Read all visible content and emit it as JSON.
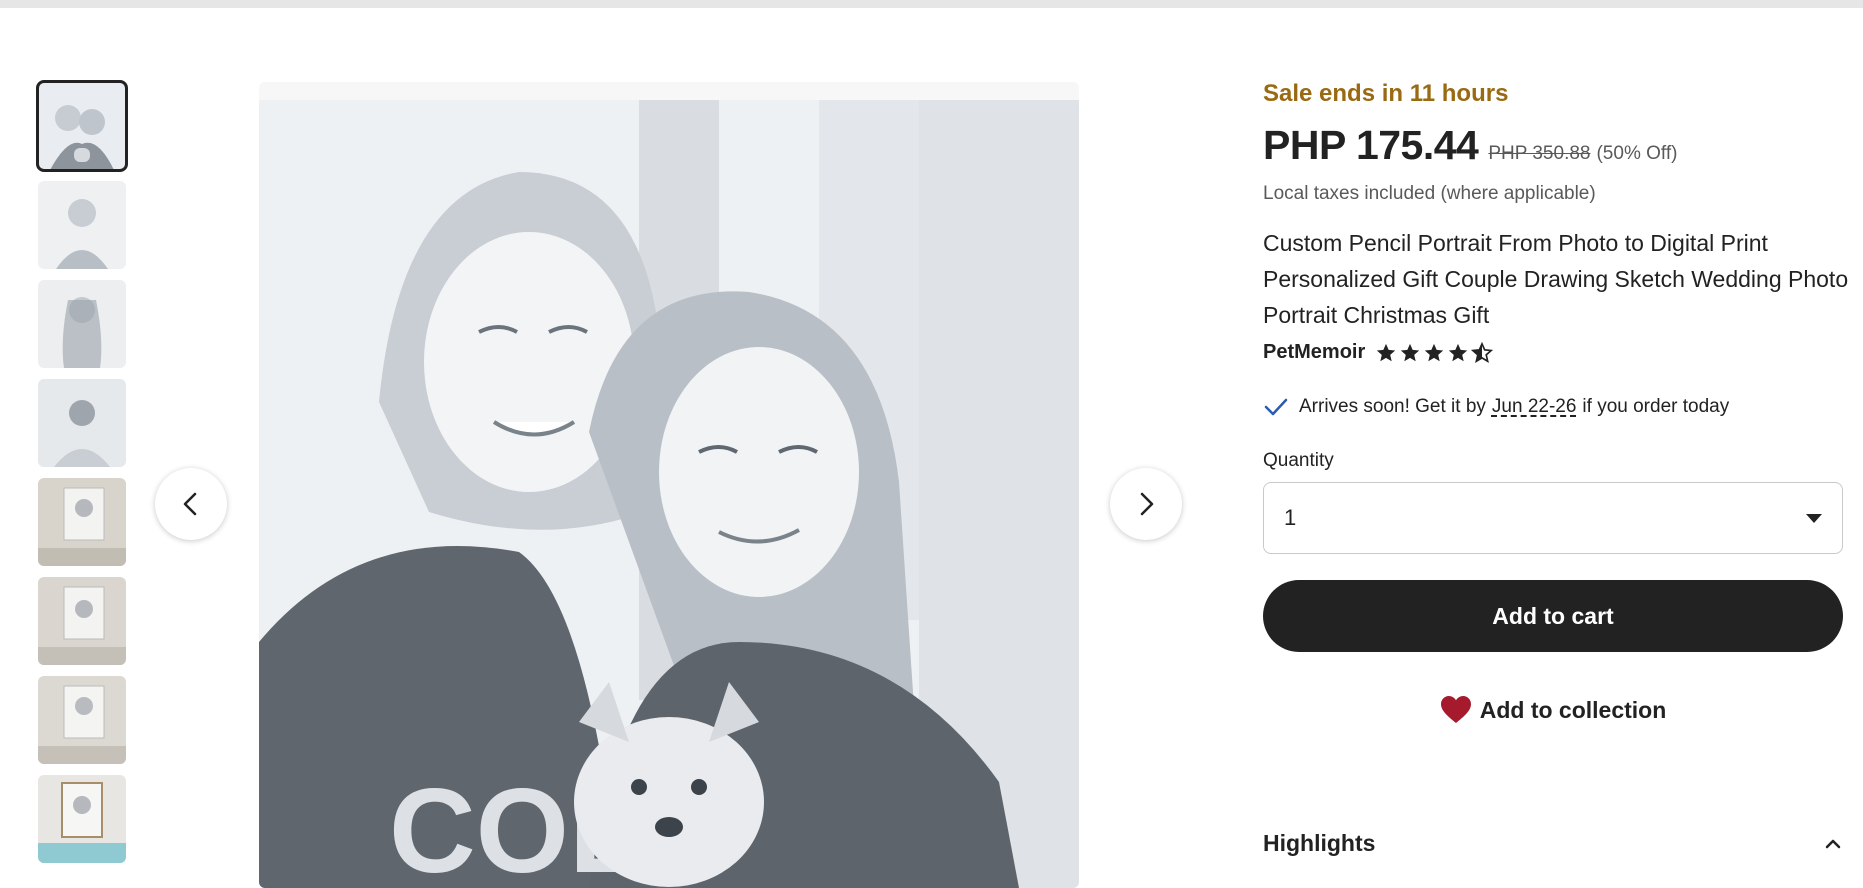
{
  "gallery": {
    "thumbnails": [
      "thumb-1",
      "thumb-2",
      "thumb-3",
      "thumb-4",
      "thumb-5",
      "thumb-6",
      "thumb-7",
      "thumb-8"
    ],
    "active_index": 0,
    "prev_icon": "chevron-left-icon",
    "next_icon": "chevron-right-icon"
  },
  "product": {
    "sale_text": "Sale ends in 11 hours",
    "price": "PHP 175.44",
    "original_price": "PHP 350.88",
    "discount": "(50% Off)",
    "taxes_note": "Local taxes included (where applicable)",
    "title": "Custom Pencil Portrait From Photo to Digital Print Personalized Gift Couple Drawing Sketch Wedding Photo Portrait Christmas Gift",
    "seller": "PetMemoir",
    "rating": 4.5
  },
  "delivery": {
    "prefix": "Arrives soon! Get it by",
    "dates": "Jun 22-26",
    "suffix": "if you order today"
  },
  "quantity": {
    "label": "Quantity",
    "selected": "1"
  },
  "actions": {
    "add_to_cart": "Add to cart",
    "add_to_collection": "Add to collection"
  },
  "highlights": {
    "label": "Highlights"
  },
  "colors": {
    "sale": "#9a6a12",
    "button": "#222222",
    "heart": "#a61a2e"
  }
}
